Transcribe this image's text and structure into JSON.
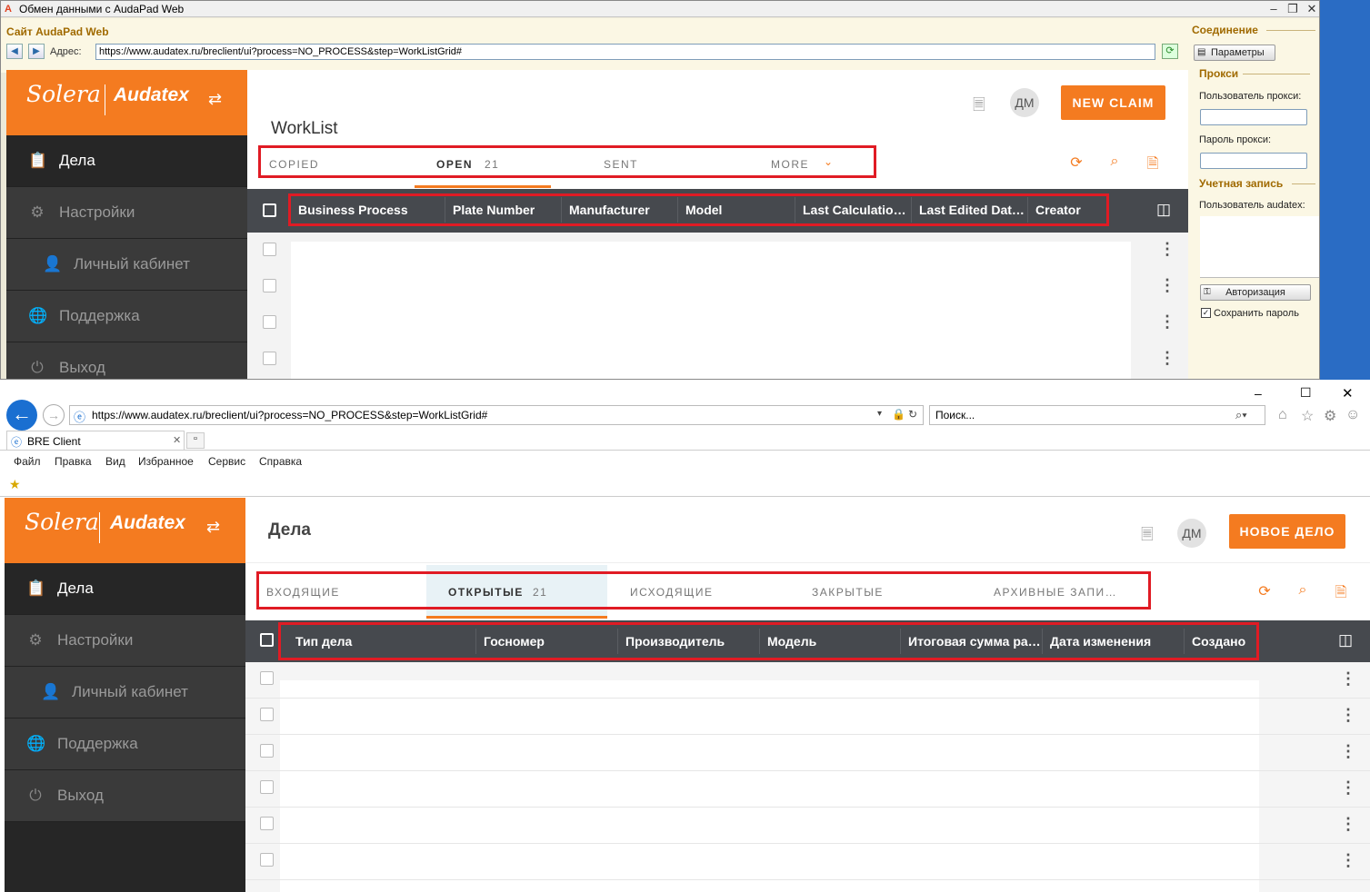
{
  "top_window": {
    "title": "Обмен данными с AudaPad Web",
    "site_label": "Сайт AudaPad Web",
    "address_label": "Адрес:",
    "url": "https://www.audatex.ru/breclient/ui?process=NO_PROCESS&step=WorkListGrid#",
    "right_panel": {
      "connection_header": "Соединение",
      "params_button": "Параметры",
      "proxy_header": "Прокси",
      "proxy_user_label": "Пользователь прокси:",
      "proxy_password_label": "Пароль прокси:",
      "account_header": "Учетная запись",
      "audatex_user_label": "Пользователь audatex:",
      "auth_button": "Авторизация",
      "save_password_label": "Сохранить пароль"
    },
    "app": {
      "brand_solera": "Solera",
      "brand_audatex": "Audatex",
      "nav": [
        {
          "label": "Дела",
          "icon": "clipboard-icon"
        },
        {
          "label": "Настройки",
          "icon": "gear-icon"
        },
        {
          "label": "Личный кабинет",
          "icon": "user-icon"
        },
        {
          "label": "Поддержка",
          "icon": "globe-icon"
        },
        {
          "label": "Выход",
          "icon": "power-icon"
        }
      ],
      "page_title": "WorkList",
      "avatar": "ДМ",
      "new_claim": "NEW CLAIM",
      "tabs": [
        "COPIED",
        "OPEN",
        "SENT",
        "MORE"
      ],
      "open_count": "21",
      "columns": [
        "Business Process",
        "Plate Number",
        "Manufacturer",
        "Model",
        "Last Calculatio…",
        "Last Edited Dat…",
        "Creator"
      ]
    }
  },
  "ie_window": {
    "url": "https://www.audatex.ru/breclient/ui?process=NO_PROCESS&step=WorkListGrid#",
    "search_placeholder": "Поиск...",
    "tab_title": "BRE Client",
    "menu": [
      "Файл",
      "Правка",
      "Вид",
      "Избранное",
      "Сервис",
      "Справка"
    ],
    "app": {
      "brand_solera": "Solera",
      "brand_audatex": "Audatex",
      "nav": [
        {
          "label": "Дела",
          "icon": "clipboard-icon"
        },
        {
          "label": "Настройки",
          "icon": "gear-icon"
        },
        {
          "label": "Личный кабинет",
          "icon": "user-icon"
        },
        {
          "label": "Поддержка",
          "icon": "globe-icon"
        },
        {
          "label": "Выход",
          "icon": "power-icon"
        }
      ],
      "page_title": "Дела",
      "avatar": "ДМ",
      "new_claim": "НОВОЕ ДЕЛО",
      "tabs": [
        "ВХОДЯЩИЕ",
        "ОТКРЫТЫЕ",
        "ИСХОДЯЩИЕ",
        "ЗАКРЫТЫЕ",
        "АРХИВНЫЕ ЗАПИ…"
      ],
      "open_count": "21",
      "columns": [
        "Тип дела",
        "Госномер",
        "Производитель",
        "Модель",
        "Итоговая сумма ра…",
        "Дата изменения",
        "Создано"
      ]
    }
  },
  "colors": {
    "accent": "#f47b20",
    "highlight_box": "#e01b24",
    "sidebar": "#2d2d2d",
    "header": "#46494e"
  }
}
